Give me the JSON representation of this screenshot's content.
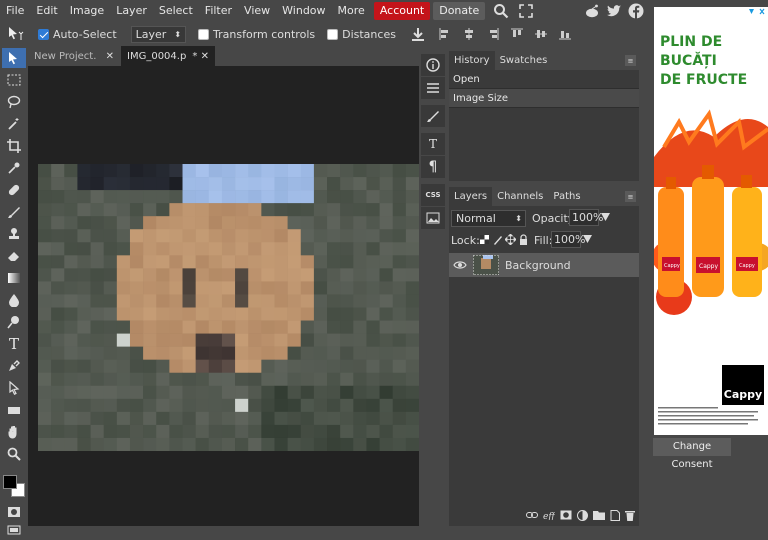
{
  "menu": {
    "items": [
      "File",
      "Edit",
      "Image",
      "Layer",
      "Select",
      "Filter",
      "View",
      "Window",
      "More"
    ],
    "account": "Account",
    "donate": "Donate"
  },
  "options": {
    "auto_select": "Auto-Select",
    "layer_select": "Layer",
    "transform_controls": "Transform controls",
    "distances": "Distances"
  },
  "tabs": [
    {
      "label": "New Project.",
      "close": "✕"
    },
    {
      "label": "IMG_0004.p",
      "modified": "*",
      "close": "✕"
    }
  ],
  "history": {
    "tabs": [
      "History",
      "Swatches"
    ],
    "rows": [
      "Open",
      "Image Size"
    ]
  },
  "layers": {
    "tabs": [
      "Layers",
      "Channels",
      "Paths"
    ],
    "blend_mode": "Normal",
    "opacity_label": "Opacity:",
    "opacity": "100%",
    "lock_label": "Lock:",
    "fill_label": "Fill:",
    "fill": "100%",
    "items": [
      {
        "name": "Background"
      }
    ]
  },
  "ad": {
    "headline_lines": [
      "PLIN DE",
      "BUCĂȚI",
      "DE FRUCTE"
    ],
    "brand": "Cappy",
    "bottle_label": "Cappy"
  },
  "consent": "Change Consent"
}
